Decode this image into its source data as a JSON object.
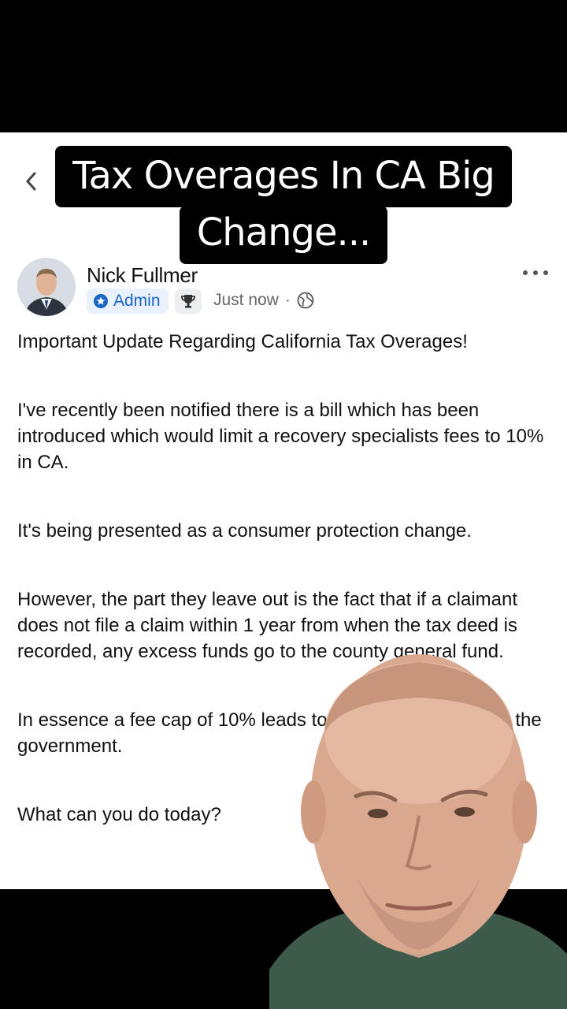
{
  "caption": {
    "line1": "Tax Overages In CA Big",
    "line2": "Change..."
  },
  "post": {
    "author": "Nick Fullmer",
    "role_badge": "Admin",
    "timestamp": "Just now",
    "separator": "·",
    "paragraphs": [
      "Important Update Regarding California Tax Overages!",
      "I've recently been notified there is a bill which has been introduced which would limit a recovery specialists fees to 10% in CA.",
      "It's being presented as a consumer protection change.",
      "However, the part they leave out is the fact that if a claimant does not file a claim within 1 year from when the tax deed is recorded, any excess funds go to the county general fund.",
      "In essence a fee cap of 10% leads to more money going to the government.",
      "What can you do today?"
    ]
  },
  "icons": {
    "admin": "admin-star-icon",
    "trophy": "trophy-icon",
    "privacy": "globe-icon",
    "more": "more-options-icon",
    "back": "chevron-left-icon"
  },
  "colors": {
    "badge_blue": "#1b66c9",
    "badge_bg": "#e8f1fc",
    "caption_bg": "#000000"
  }
}
